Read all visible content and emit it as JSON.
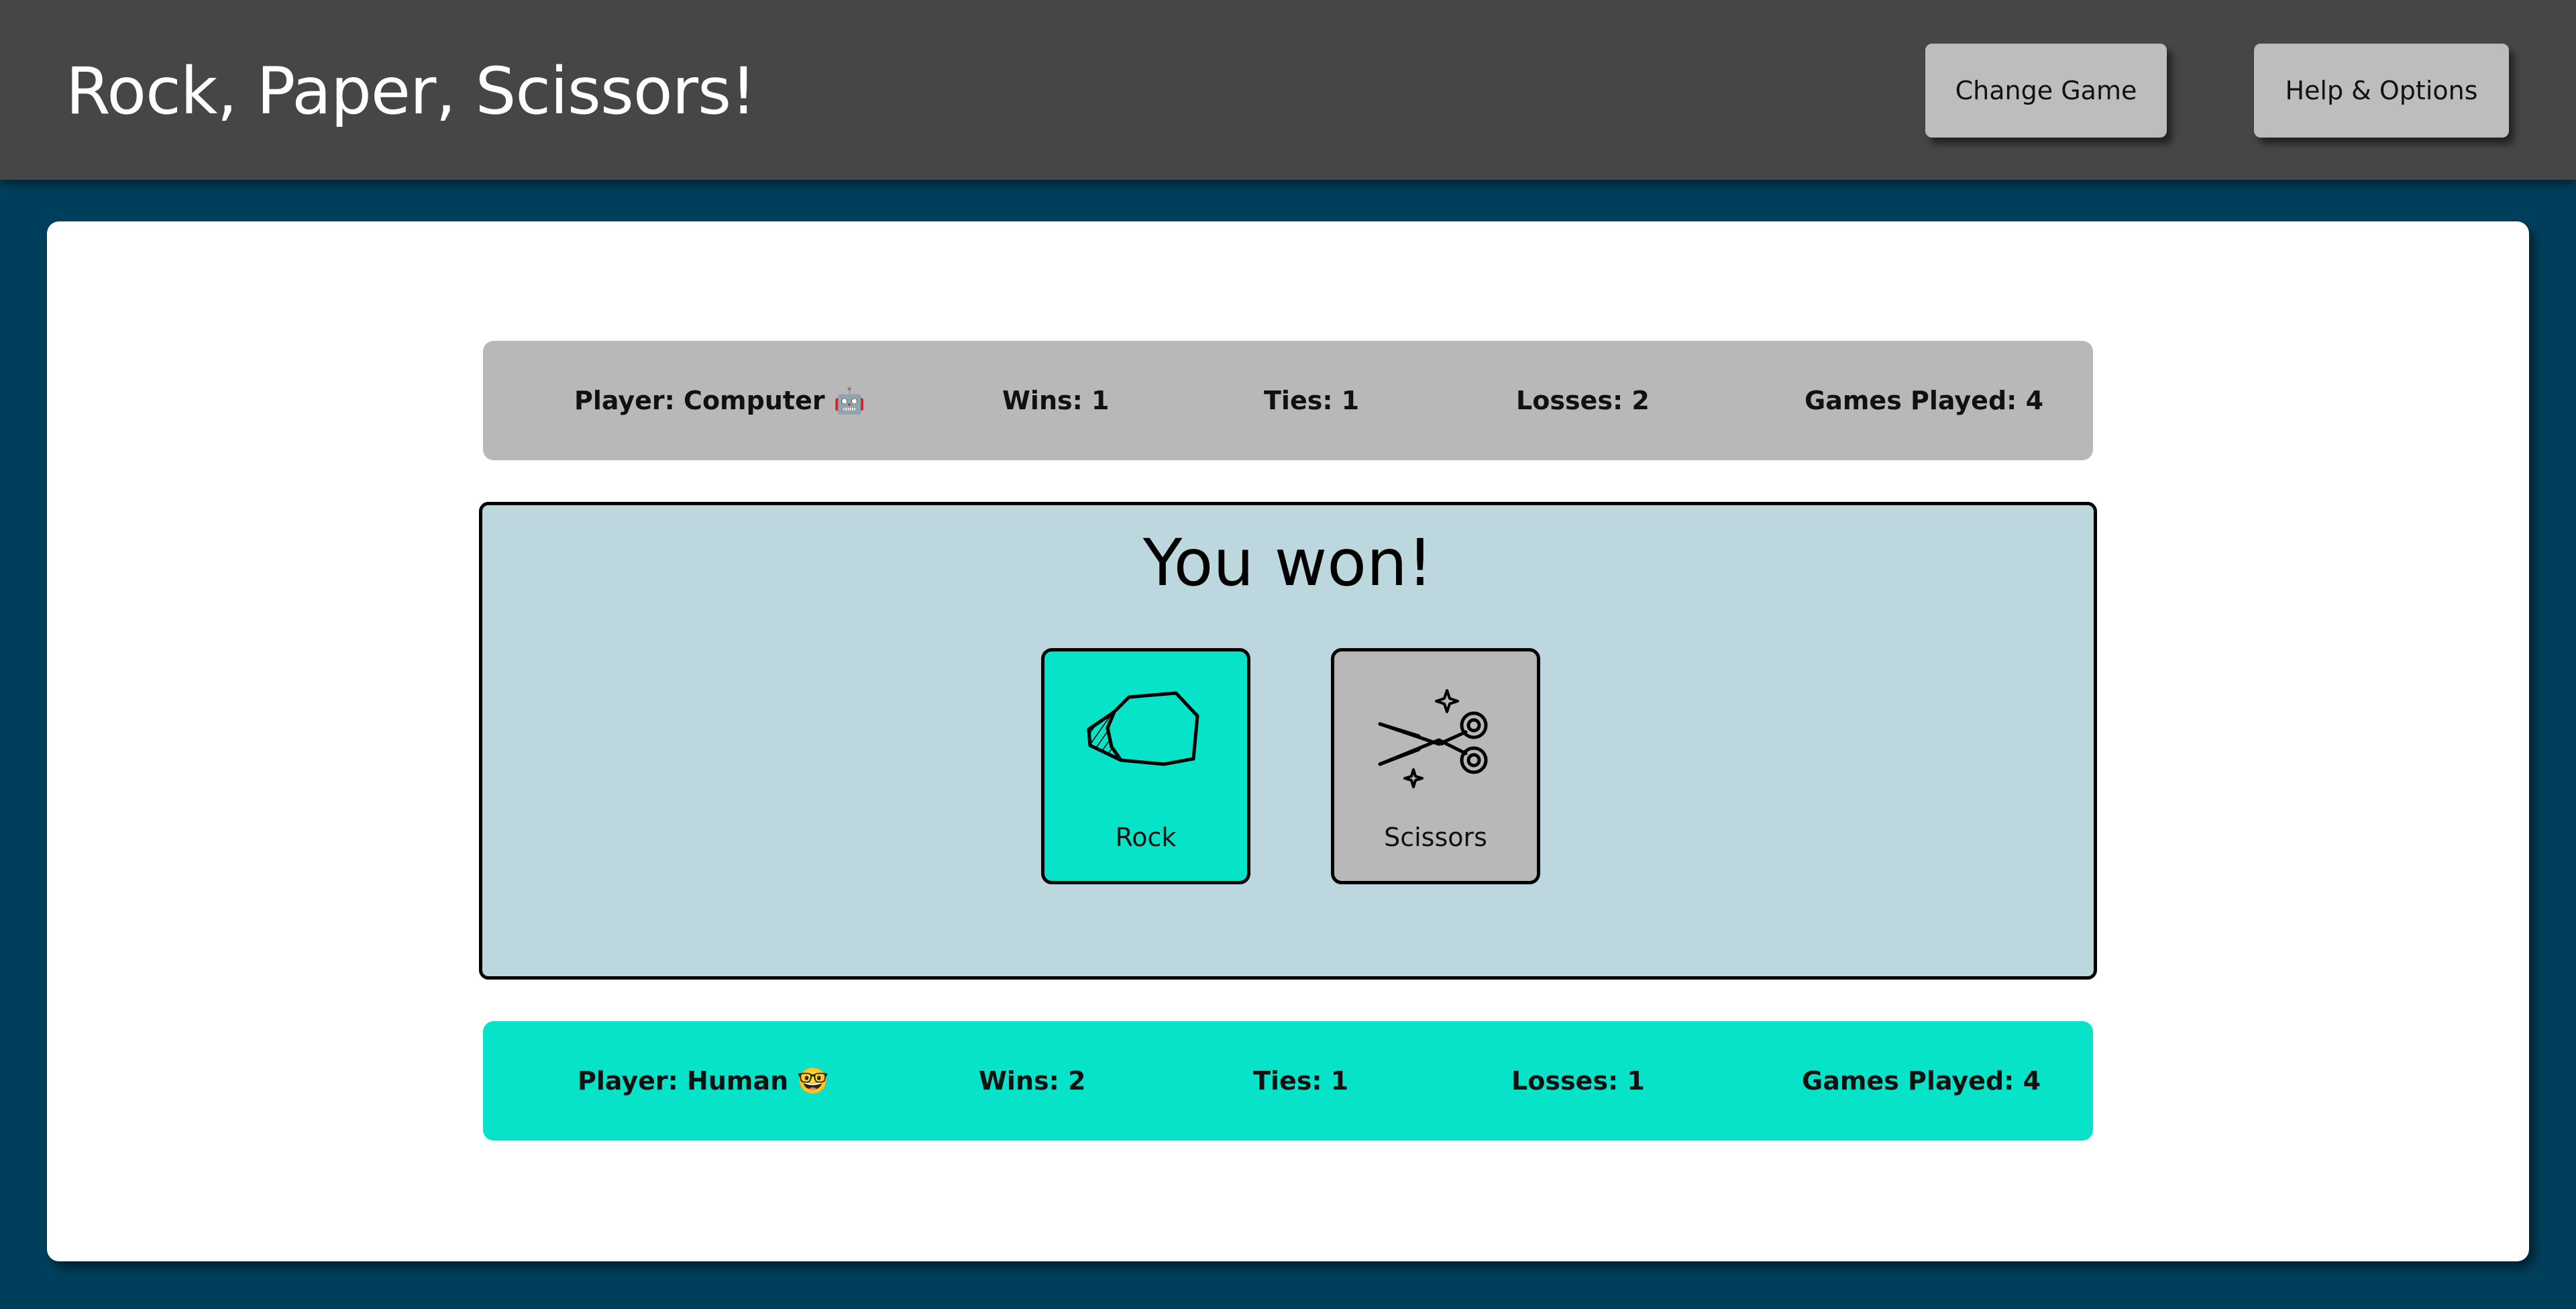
{
  "header": {
    "title": "Rock, Paper, Scissors!",
    "change_game_label": "Change Game",
    "help_label": "Help & Options"
  },
  "computer": {
    "player": "Player: Computer 🤖",
    "wins": "Wins: 1",
    "ties": "Ties: 1",
    "losses": "Losses: 2",
    "games_played": "Games Played: 4"
  },
  "result": {
    "message": "You won!",
    "human_choice": {
      "label": "Rock",
      "icon": "rock-icon"
    },
    "computer_choice": {
      "label": "Scissors",
      "icon": "scissors-icon"
    }
  },
  "human": {
    "player": "Player: Human 🤓",
    "wins": "Wins: 2",
    "ties": "Ties: 1",
    "losses": "Losses: 1",
    "games_played": "Games Played: 4"
  },
  "colors": {
    "header_bg": "#464646",
    "page_bg": "#003f5c",
    "accent": "#06e3c8",
    "computer_bar": "#b8b8b8",
    "result_panel": "#bdd7de"
  }
}
